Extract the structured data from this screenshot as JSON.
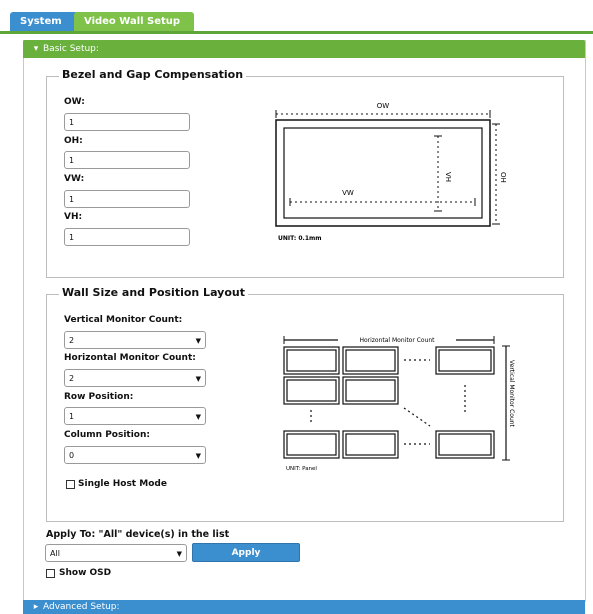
{
  "tabs": {
    "system": "System",
    "video_wall": "Video Wall Setup"
  },
  "basic": {
    "header": "Basic Setup:",
    "bezel": {
      "title": "Bezel and Gap Compensation",
      "ow_label": "OW:",
      "ow_value": "1",
      "oh_label": "OH:",
      "oh_value": "1",
      "vw_label": "VW:",
      "vw_value": "1",
      "vh_label": "VH:",
      "vh_value": "1",
      "diagram": {
        "ow": "OW",
        "oh": "OH",
        "vw": "VW",
        "vh": "VH",
        "unit": "UNIT: 0.1mm"
      }
    },
    "wall": {
      "title": "Wall Size and Position Layout",
      "vertical_label": "Vertical Monitor Count:",
      "vertical_value": "2",
      "horizontal_label": "Horizontal Monitor Count:",
      "horizontal_value": "2",
      "row_label": "Row Position:",
      "row_value": "1",
      "column_label": "Column Position:",
      "column_value": "0",
      "single_host_label": "Single Host Mode",
      "diagram": {
        "horizontal": "Horizontal Monitor Count",
        "vertical": "Vertical Monitor Count",
        "unit": "UNIT: Panel"
      }
    },
    "apply_to_label": "Apply To: \"All\" device(s) in the list",
    "apply_target": "All",
    "apply_button": "Apply",
    "show_osd_label": "Show OSD"
  },
  "advanced": {
    "header": "Advanced Setup:"
  },
  "icons": {
    "expanded": "triangle-down-icon",
    "collapsed": "triangle-right-icon",
    "dropdown": "chevron-down-icon"
  }
}
